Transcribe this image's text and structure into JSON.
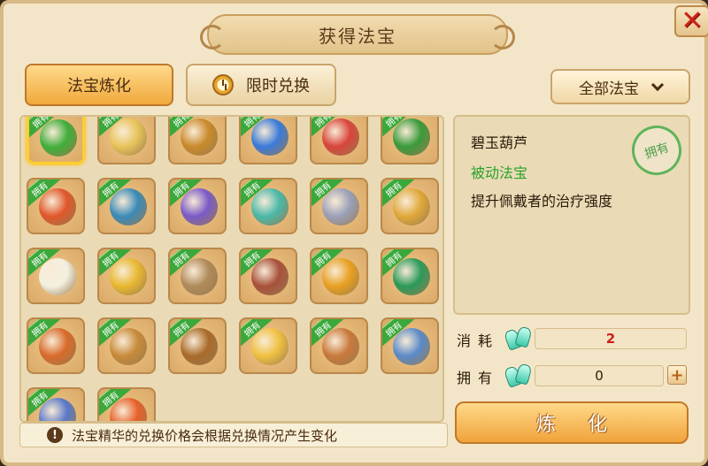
{
  "title": "获得法宝",
  "tabs": [
    {
      "label": "法宝炼化",
      "active": true
    },
    {
      "label": "限时兑换",
      "active": false
    }
  ],
  "filter": {
    "label": "全部法宝"
  },
  "owned_badge": "拥有",
  "grid": {
    "items": [
      {
        "name": "碧玉葫芦",
        "icon": "gourd-icon",
        "owned": true,
        "selected": true,
        "color": "#3fae3a"
      },
      {
        "name": "",
        "icon": "crossed-swords-icon",
        "owned": true,
        "color": "#e8c45a"
      },
      {
        "name": "",
        "icon": "treasure-bag-icon",
        "owned": true,
        "color": "#c98a2a"
      },
      {
        "name": "",
        "icon": "blue-gem-icon",
        "owned": true,
        "color": "#3a7ad8"
      },
      {
        "name": "",
        "icon": "red-orb-icon",
        "owned": true,
        "color": "#d8443a"
      },
      {
        "name": "",
        "icon": "green-dragon-icon",
        "owned": true,
        "color": "#3a9a3a"
      },
      {
        "name": "",
        "icon": "flame-sword-icon",
        "owned": true,
        "color": "#e0562a"
      },
      {
        "name": "",
        "icon": "blue-beast-icon",
        "owned": true,
        "color": "#3a8ab8"
      },
      {
        "name": "",
        "icon": "armored-guardian-icon",
        "owned": true,
        "color": "#7a5ac8"
      },
      {
        "name": "",
        "icon": "jade-chariot-icon",
        "owned": true,
        "color": "#4ab8a8"
      },
      {
        "name": "",
        "icon": "pagoda-icon",
        "owned": true,
        "color": "#9aa0b8"
      },
      {
        "name": "",
        "icon": "golden-pagoda-icon",
        "owned": true,
        "color": "#e0a83a"
      },
      {
        "name": "",
        "icon": "ghost-scroll-icon",
        "owned": true,
        "color": "#f4f0e0"
      },
      {
        "name": "",
        "icon": "golden-fan-icon",
        "owned": true,
        "color": "#e8b830"
      },
      {
        "name": "",
        "icon": "puppet-icon",
        "owned": true,
        "color": "#b08a5a"
      },
      {
        "name": "",
        "icon": "stone-seal-icon",
        "owned": true,
        "color": "#a8503a"
      },
      {
        "name": "",
        "icon": "golden-bell-icon",
        "owned": true,
        "color": "#e8a020"
      },
      {
        "name": "",
        "icon": "green-umbrella-icon",
        "owned": true,
        "color": "#2a9a5a"
      },
      {
        "name": "",
        "icon": "coiled-rope-icon",
        "owned": true,
        "color": "#d86a2a"
      },
      {
        "name": "",
        "icon": "beast-mask-icon",
        "owned": true,
        "color": "#c88a3a"
      },
      {
        "name": "",
        "icon": "crossbow-icon",
        "owned": true,
        "color": "#a86a2a"
      },
      {
        "name": "",
        "icon": "golden-gourd-icon",
        "owned": true,
        "color": "#f0c040"
      },
      {
        "name": "",
        "icon": "scroll-icon",
        "owned": true,
        "color": "#c8783a"
      },
      {
        "name": "",
        "icon": "open-book-icon",
        "owned": true,
        "color": "#5a8ac8"
      },
      {
        "name": "",
        "icon": "blue-cauldron-icon",
        "owned": true,
        "color": "#5a78c8"
      },
      {
        "name": "",
        "icon": "fire-pouch-icon",
        "owned": true,
        "color": "#e8602a"
      }
    ]
  },
  "tip": {
    "icon": "exclamation-icon",
    "text": "法宝精华的兑换价格会根据兑换情况产生变化"
  },
  "detail": {
    "name": "碧玉葫芦",
    "type": "被动法宝",
    "description": "提升佩戴者的治疗强度",
    "stamp": "拥有"
  },
  "cost": {
    "label": "消耗",
    "icon": "jade-essence-icon",
    "value": "2"
  },
  "owned": {
    "label": "拥有",
    "icon": "jade-essence-icon",
    "value": "0",
    "plus": "+"
  },
  "refine_button": "炼化",
  "colors": {
    "accent": "#f0a93c",
    "owned_green": "#3aa83a",
    "cost_red": "#d02018"
  }
}
